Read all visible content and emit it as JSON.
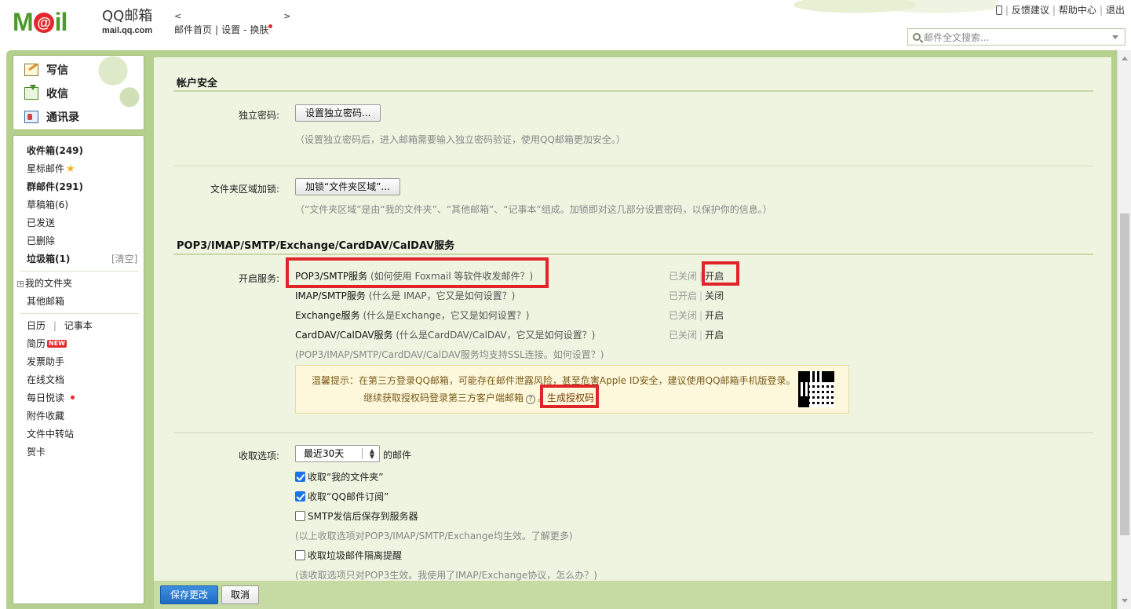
{
  "header": {
    "brand_name": "QQ邮箱",
    "brand_domain": "mail.qq.com",
    "nav_back": "<",
    "nav_forward": ">",
    "nav_home": "邮件首页",
    "nav_settings": "设置",
    "nav_skin": "换肤",
    "link_feedback": "反馈建议",
    "link_help": "帮助中心",
    "link_logout": "退出",
    "search_placeholder": "邮件全文搜索..."
  },
  "compose": {
    "write": "写信",
    "receive": "收信",
    "contacts": "通讯录"
  },
  "folders": {
    "inbox": "收件箱(249)",
    "starred": "星标邮件",
    "group": "群邮件(291)",
    "drafts": "草稿箱(6)",
    "sent": "已发送",
    "deleted": "已删除",
    "spam": "垃圾箱(1)",
    "spam_clear": "[清空]",
    "my_folders": "我的文件夹",
    "other_mail": "其他邮箱",
    "calendar": "日历",
    "notes": "记事本",
    "resume": "简历",
    "resume_badge": "NEW",
    "invoice": "发票助手",
    "docs": "在线文档",
    "daily": "每日悦读",
    "attachments": "附件收藏",
    "transfer": "文件中转站",
    "cards": "贺卡"
  },
  "security": {
    "title": "帐户安全",
    "pwd_label": "独立密码:",
    "pwd_button": "设置独立密码...",
    "pwd_hint": "（设置独立密码后，进入邮箱需要输入独立密码验证，使用QQ邮箱更加安全。）",
    "lock_label": "文件夹区域加锁:",
    "lock_button": "加锁“文件夹区域”...",
    "lock_hint": "（“文件夹区域”是由“我的文件夹”、“其他邮箱”、“记事本”组成。加锁即对这几部分设置密码，以保护你的信息。）"
  },
  "services": {
    "title": "POP3/IMAP/SMTP/Exchange/CardDAV/CalDAV服务",
    "enable_label": "开启服务:",
    "items": [
      {
        "name": "POP3/SMTP服务",
        "help": "(如何使用 Foxmail 等软件收发邮件？)",
        "state": "已关闭",
        "action": "开启"
      },
      {
        "name": "IMAP/SMTP服务",
        "help": "(什么是 IMAP，它又是如何设置？)",
        "state": "已开启",
        "action": "关闭"
      },
      {
        "name": "Exchange服务",
        "help": "(什么是Exchange，它又是如何设置？)",
        "state": "已关闭",
        "action": "开启"
      },
      {
        "name": "CardDAV/CalDAV服务",
        "help": "(什么是CardDAV/CalDAV，它又是如何设置？)",
        "state": "已关闭",
        "action": "开启"
      }
    ],
    "ssl_hint": "(POP3/IMAP/SMTP/CardDAV/CalDAV服务均支持SSL连接。如何设置？)",
    "tip_line1": "温馨提示：在第三方登录QQ邮箱，可能存在邮件泄露风险，甚至危害Apple ID安全，建议使用QQ邮箱手机版登录。",
    "tip_line2": "继续获取授权码登录第三方客户端邮箱",
    "tip_help": "?",
    "tip_dot": "。",
    "tip_link": "生成授权码"
  },
  "receive": {
    "label": "收取选项:",
    "range": "最近30天",
    "suffix": "的邮件",
    "opt1": "收取“我的文件夹”",
    "opt1_checked": true,
    "opt2": "收取“QQ邮件订阅”",
    "opt2_checked": true,
    "opt3": "SMTP发信后保存到服务器",
    "opt3_checked": false,
    "hint1": "(以上收取选项对POP3/IMAP/SMTP/Exchange均生效。了解更多)",
    "opt4": "收取垃圾邮件隔离提醒",
    "opt4_checked": false,
    "hint2": "(该收取选项只对POP3生效。我使用了IMAP/Exchange协议，怎么办？)"
  },
  "footer": {
    "save": "保存更改",
    "cancel": "取消"
  },
  "colors": {
    "frame": "#b5cf8e",
    "panel": "#eef4e0",
    "highlight": "#e0252a",
    "primary": "#1f6cc4"
  }
}
